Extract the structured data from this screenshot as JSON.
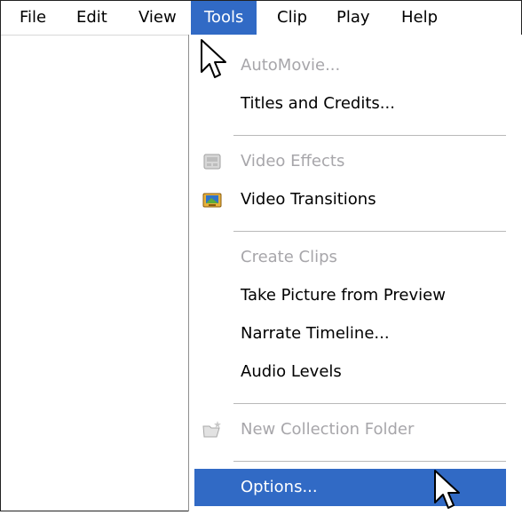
{
  "menubar": {
    "items": [
      {
        "label": "File"
      },
      {
        "label": "Edit"
      },
      {
        "label": "View"
      },
      {
        "label": "Tools",
        "active": true
      },
      {
        "label": "Clip"
      },
      {
        "label": "Play"
      },
      {
        "label": "Help"
      }
    ]
  },
  "tools_menu": {
    "items": [
      {
        "label": "AutoMovie...",
        "enabled": false
      },
      {
        "label": "Titles and Credits...",
        "enabled": true
      },
      {
        "label": "Video Effects",
        "enabled": false,
        "icon": "video-effects-icon"
      },
      {
        "label": "Video Transitions",
        "enabled": true,
        "icon": "video-transitions-icon"
      },
      {
        "label": "Create Clips",
        "enabled": false
      },
      {
        "label": "Take Picture from Preview",
        "enabled": true
      },
      {
        "label": "Narrate Timeline...",
        "enabled": true
      },
      {
        "label": "Audio Levels",
        "enabled": true
      },
      {
        "label": "New Collection Folder",
        "enabled": false,
        "icon": "new-folder-icon"
      },
      {
        "label": "Options...",
        "enabled": true,
        "selected": true
      }
    ]
  },
  "colors": {
    "highlight": "#316ac5",
    "disabled_text": "#a7a6aa",
    "separator": "#b9b9b9"
  }
}
